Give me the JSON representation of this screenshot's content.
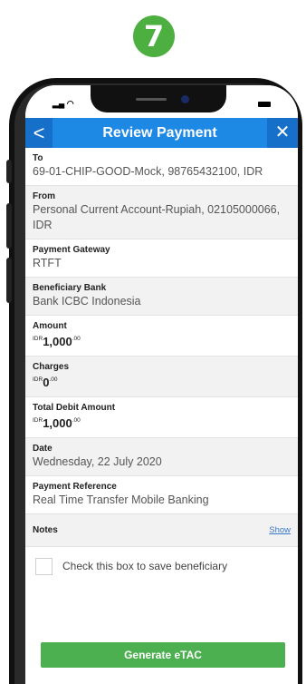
{
  "step": {
    "number": "7"
  },
  "header": {
    "title": "Review Payment",
    "back_glyph": "<",
    "close_glyph": "✕"
  },
  "fields": {
    "to": {
      "label": "To",
      "value": "69-01-CHIP-GOOD-Mock, 98765432100, IDR"
    },
    "from": {
      "label": "From",
      "value": "Personal Current Account-Rupiah, 02105000066, IDR"
    },
    "gateway": {
      "label": "Payment Gateway",
      "value": "RTFT"
    },
    "bank": {
      "label": "Beneficiary Bank",
      "value": "Bank ICBC Indonesia"
    },
    "amount": {
      "label": "Amount",
      "currency": "IDR",
      "whole": "1,000",
      "decimal": ".00"
    },
    "charges": {
      "label": "Charges",
      "currency": "IDR",
      "whole": "0",
      "decimal": ".00"
    },
    "total": {
      "label": "Total Debit Amount",
      "currency": "IDR",
      "whole": "1,000",
      "decimal": ".00"
    },
    "date": {
      "label": "Date",
      "value": "Wednesday, 22 July 2020"
    },
    "reference": {
      "label": "Payment Reference",
      "value": "Real Time Transfer Mobile Banking"
    }
  },
  "notes": {
    "label": "Notes",
    "show_link": "Show"
  },
  "save_beneficiary": {
    "label": "Check this box to save beneficiary",
    "checked": false
  },
  "primary_action": {
    "label": "Generate eTAC"
  },
  "colors": {
    "header": "#1e88e5",
    "button": "#4caf50",
    "badge": "#4caf3f"
  }
}
